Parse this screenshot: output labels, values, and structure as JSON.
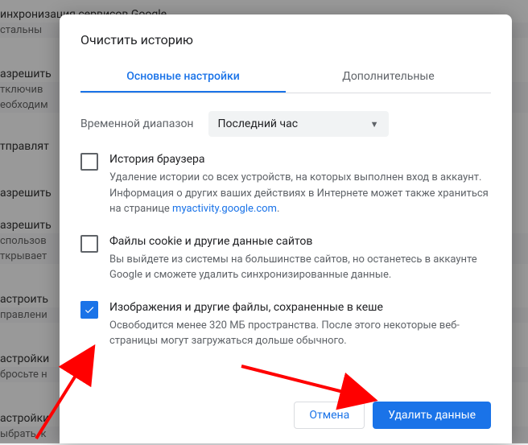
{
  "background": {
    "line0": "инхронизация сервисов Google",
    "line0sub": "стальны  ",
    "line1": "азрешить",
    "line1sub": "тключив    ",
    "line1sub2": "еобходим",
    "line2": "тправлят  ",
    "line3": "азрешить",
    "line4": "азрешить",
    "line4sub": "спользов  ",
    "line4sub2": "ткрывает",
    "line5": "астроить",
    "line5sub": "правлени  ",
    "line6": "астройки",
    "line6sub": "бросьте н",
    "line7": "астройки",
    "line7sub": "ыбрать, к"
  },
  "dialog": {
    "title": "Очистить историю",
    "tabs": {
      "basic": "Основные настройки",
      "advanced": "Дополнительные"
    },
    "range": {
      "label": "Временной диапазон",
      "value": "Последний час"
    },
    "opts": [
      {
        "title": "История браузера",
        "desc_before": "Удаление истории со всех устройств, на которых выполнен вход в аккаунт. Информация о других ваших действиях в Интернете может также храниться на странице ",
        "link": "myactivity.google.com",
        "desc_after": ".",
        "checked": false
      },
      {
        "title": "Файлы cookie и другие данные сайтов",
        "desc": "Вы выйдете из системы на большинстве сайтов, но останетесь в аккаунте Google и сможете удалить синхронизированные данные.",
        "checked": false
      },
      {
        "title": "Изображения и другие файлы, сохраненные в кеше",
        "desc": "Освободится менее 320 МБ пространства. После этого некоторые веб-страницы могут загружаться дольше обычного.",
        "checked": true
      }
    ],
    "buttons": {
      "cancel": "Отмена",
      "confirm": "Удалить данные"
    }
  }
}
